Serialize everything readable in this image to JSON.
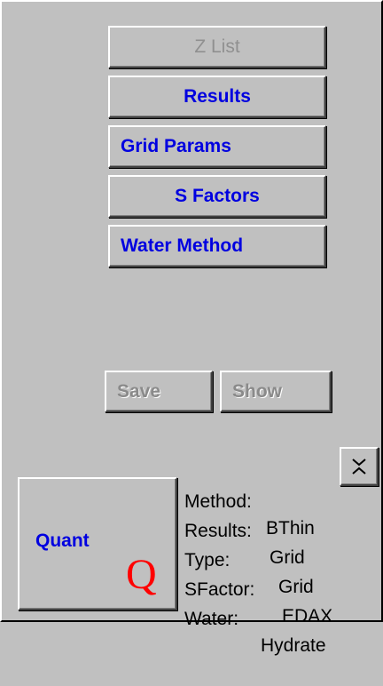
{
  "buttons": {
    "zlist": "Z List",
    "results": "Results",
    "grid_params": "Grid Params",
    "s_factors": "S Factors",
    "water_method": "Water Method",
    "save": "Save",
    "show": "Show",
    "quant": "Quant",
    "quant_icon": "Q",
    "collapse_icon": "chevron-collapse-icon"
  },
  "info": {
    "method_label": "Method:",
    "method_value": "BThin",
    "results_label": "Results:",
    "results_value": "Grid",
    "type_label": "Type:",
    "type_value": "Grid",
    "sfactor_label": "SFactor:",
    "sfactor_value": "EDAX",
    "water_label": "Water:",
    "water_value": "Hydrate"
  },
  "colors": {
    "background": "#c0c0c0",
    "active_text": "#0000e0",
    "disabled_text": "#909090",
    "quant_icon": "#ff0000"
  }
}
